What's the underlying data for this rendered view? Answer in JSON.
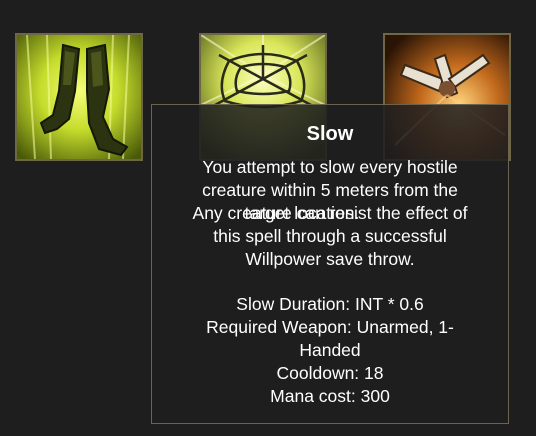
{
  "skills": [
    {
      "name": "legs-skill-icon",
      "accent": "#d6ee3a"
    },
    {
      "name": "web-skill-icon",
      "accent": "#e2ec5c"
    },
    {
      "name": "blades-skill-icon",
      "accent": "#e69a3c"
    }
  ],
  "tooltip": {
    "title": "Slow",
    "description": {
      "line1": "You attempt to slow every hostile",
      "line2": "creature within 5 meters from the",
      "line3a": "target location.",
      "line3b": "Any creature can resist the effect of",
      "line4": "this spell through a successful",
      "line5": "Willpower save throw."
    },
    "stats": {
      "duration": "Slow Duration: INT * 0.6",
      "weapon_line1": "Required Weapon: Unarmed, 1-",
      "weapon_line2": "Handed",
      "cooldown": "Cooldown: 18",
      "mana_cost": "Mana cost: 300"
    }
  }
}
